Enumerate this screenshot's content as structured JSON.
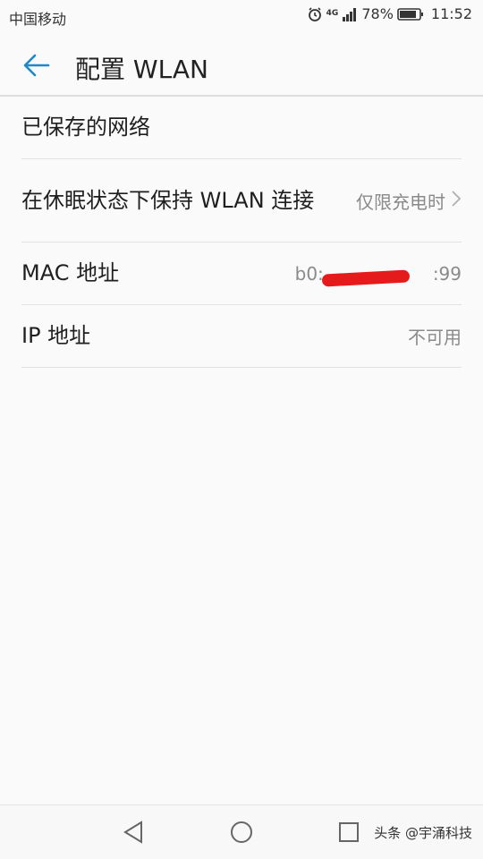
{
  "status": {
    "carrier": "中国移动",
    "network": "4G",
    "battery": "78%",
    "time": "11:52"
  },
  "header": {
    "title": "配置 WLAN"
  },
  "settings": [
    {
      "label": "已保存的网络"
    },
    {
      "label": "在休眠状态下保持 WLAN 连接",
      "value": "仅限充电时"
    },
    {
      "label": "MAC 地址",
      "value_prefix": "b0:",
      "value_suffix": ":99"
    },
    {
      "label": "IP 地址",
      "value": "不可用"
    }
  ],
  "watermark": "头条 @宇涌科技",
  "colors": {
    "accent": "#1e88c8",
    "redaction": "#e51a1a"
  }
}
